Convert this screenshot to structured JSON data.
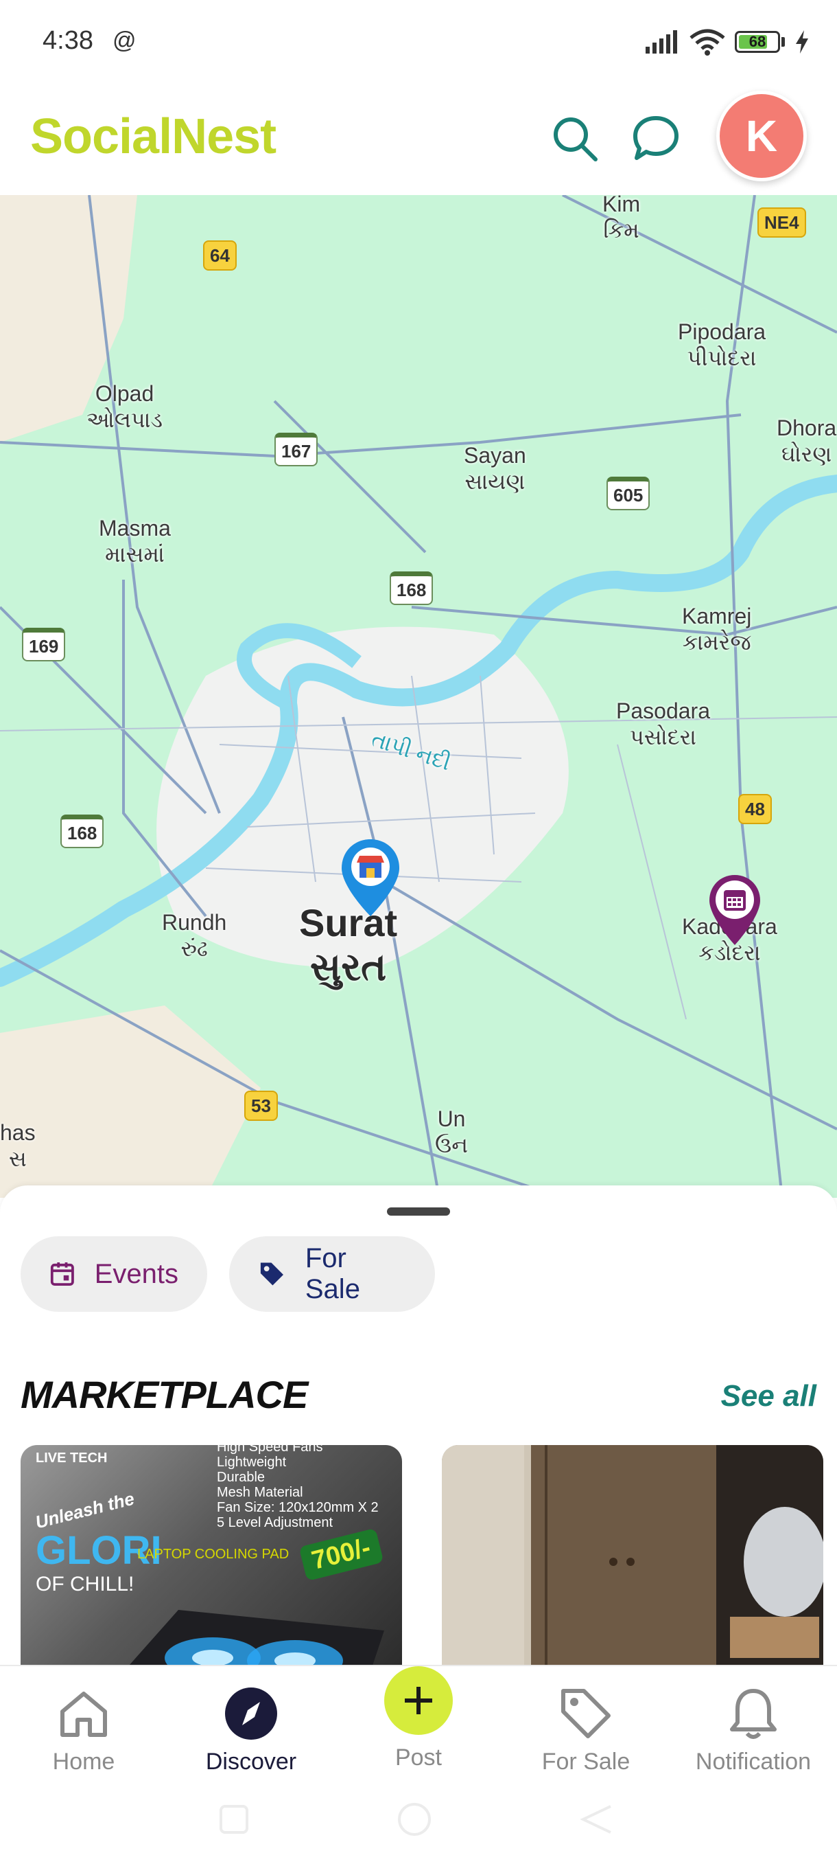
{
  "status_bar": {
    "time": "4:38",
    "battery": "68"
  },
  "app_bar": {
    "title": "SocialNest",
    "avatar_initial": "K"
  },
  "map": {
    "places": [
      {
        "name": "Kim",
        "local": "કિમ"
      },
      {
        "name": "Pipodara",
        "local": "પીપોદરા"
      },
      {
        "name": "Olpad",
        "local": "ઓલપાડ"
      },
      {
        "name": "Sayan",
        "local": "સાયણ"
      },
      {
        "name": "Dhora",
        "local": "ઘોરણ"
      },
      {
        "name": "Masma",
        "local": "માસમાં"
      },
      {
        "name": "Kamrej",
        "local": "કામરેજ"
      },
      {
        "name": "Pasodara",
        "local": "પસોદરા"
      },
      {
        "name": "Rundh",
        "local": "રુંઢ"
      },
      {
        "name": "Surat",
        "local": "સુરત"
      },
      {
        "name": "Kadodara",
        "local": "કડોદરા"
      },
      {
        "name": "Un",
        "local": "ઉન"
      },
      {
        "name": "has",
        "local": "સ"
      }
    ],
    "river": "તાપી નદી",
    "shields": [
      "64",
      "NE4",
      "167",
      "605",
      "168",
      "169",
      "168",
      "48",
      "53"
    ]
  },
  "filters": {
    "events": "Events",
    "for_sale": "For Sale"
  },
  "marketplace": {
    "title": "MARKETPLACE",
    "see_all": "See all",
    "card1": {
      "brand": "LIVE TECH",
      "features": [
        "High Speed Fans",
        "Lightweight",
        "Durable",
        "Mesh Material",
        "Fan Size: 120x120mm X 2",
        "5 Level Adjustment"
      ],
      "tagline1": "Unleash the",
      "product": "GLORI",
      "product_sub": "LAPTOP COOLING PAD",
      "tagline2": "OF CHILL!",
      "price": "700/-"
    }
  },
  "bottom_nav": [
    {
      "label": "Home"
    },
    {
      "label": "Discover"
    },
    {
      "label": "Post"
    },
    {
      "label": "For Sale"
    },
    {
      "label": "Notification"
    }
  ]
}
